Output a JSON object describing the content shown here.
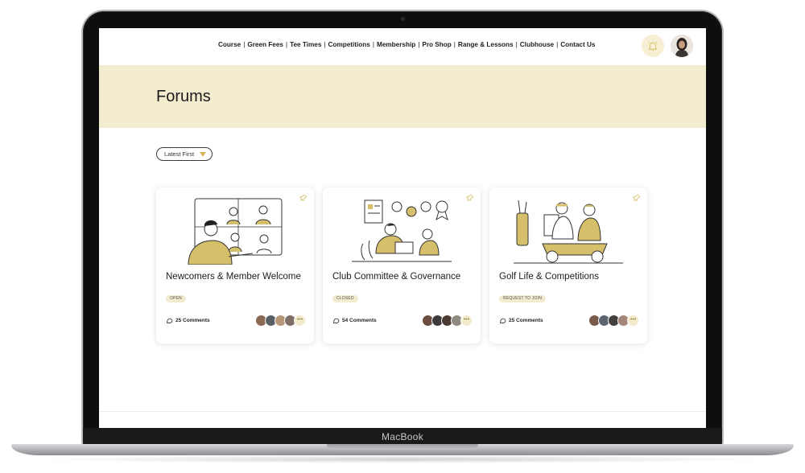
{
  "device": {
    "brand": "MacBook"
  },
  "nav": {
    "items": [
      "Course",
      "Green Fees",
      "Tee Times",
      "Competitions",
      "Membership",
      "Pro Shop",
      "Range & Lessons",
      "Clubhouse",
      "Contact Us"
    ],
    "separator": "|"
  },
  "header": {
    "notification_icon": "bell-icon",
    "avatar": "user-avatar"
  },
  "page": {
    "title": "Forums"
  },
  "sort": {
    "label": "Latest First",
    "icon": "caret-down-icon"
  },
  "forums": [
    {
      "title": "Newcomers & Member Welcome",
      "status": "OPEN",
      "comments": "25 Comments",
      "more": "•••"
    },
    {
      "title": "Club Committee & Governance",
      "status": "CLOSED",
      "comments": "54 Comments",
      "more": "•••"
    },
    {
      "title": "Golf Life & Competitions",
      "status": "REQUEST TO JOIN",
      "comments": "25 Comments",
      "more": "•••"
    }
  ],
  "colors": {
    "accent": "#d6bf6a",
    "hero_bg": "#f3eccf",
    "badge_bg": "#f2ebcd"
  }
}
